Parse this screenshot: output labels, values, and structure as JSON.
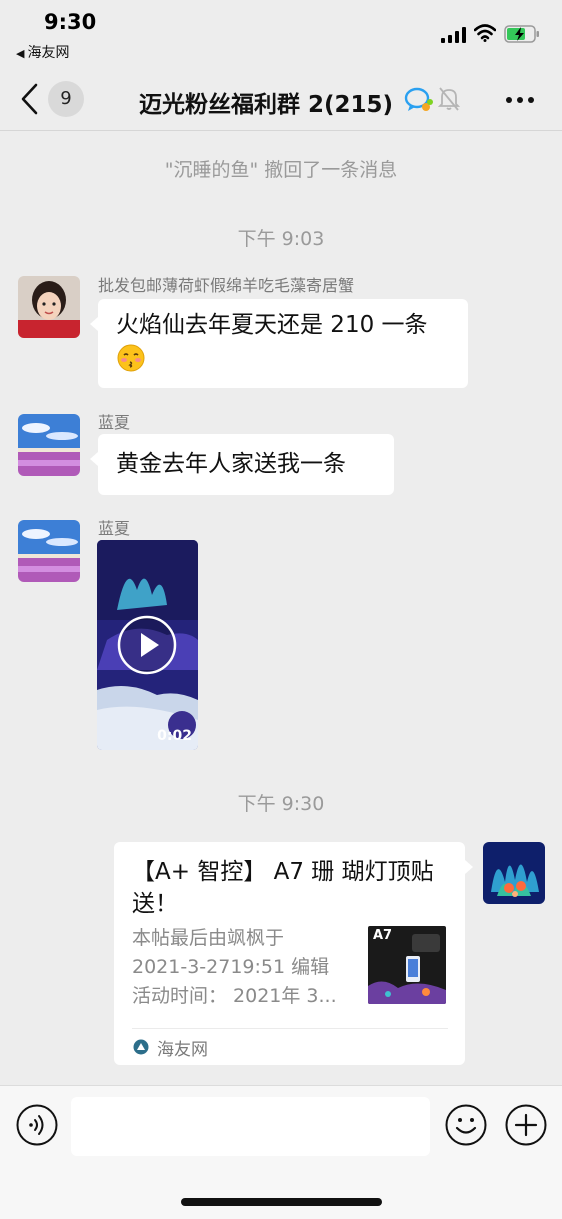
{
  "status_bar": {
    "time": "9:30",
    "back_app_arrow": "◀",
    "back_app": "海友网"
  },
  "header": {
    "unread_count": "9",
    "title": "迈光粉丝福利群 2(215)",
    "icons": [
      "back-chevron-icon",
      "group-chat-icon",
      "mute-bell-icon",
      "more-dots-icon"
    ]
  },
  "system_messages": {
    "recall_notice": "\"沉睡的鱼\" 撤回了一条消息",
    "time_1": "下午 9:03",
    "time_2": "下午 9:30"
  },
  "messages": [
    {
      "sender": "批发包邮薄荷虾假绵羊吃毛藻寄居蟹",
      "text": "火焰仙去年夏天还是 210 一条",
      "emoji": "kissing-face-emoji"
    },
    {
      "sender": "蓝夏",
      "text": "黄金去年人家送我一条"
    },
    {
      "sender": "蓝夏",
      "video_duration": "0:02"
    }
  ],
  "link_card": {
    "title": "【A+ 智控】 A7 珊 瑚灯顶贴送！",
    "desc_line1": "本帖最后由飒枫于",
    "desc_line2": "2021-3-2719:51 编辑",
    "desc_line3": "活动时间： 2021年 3...",
    "thumb_label": "A7",
    "source": "海友网"
  },
  "input_bar": {
    "placeholder": "",
    "icons": [
      "voice-icon",
      "emoji-icon",
      "plus-icon"
    ]
  },
  "colors": {
    "background": "#ededed",
    "bubble": "#ffffff",
    "system_text": "#9a9a9a",
    "battery_charging": "#34c759"
  }
}
